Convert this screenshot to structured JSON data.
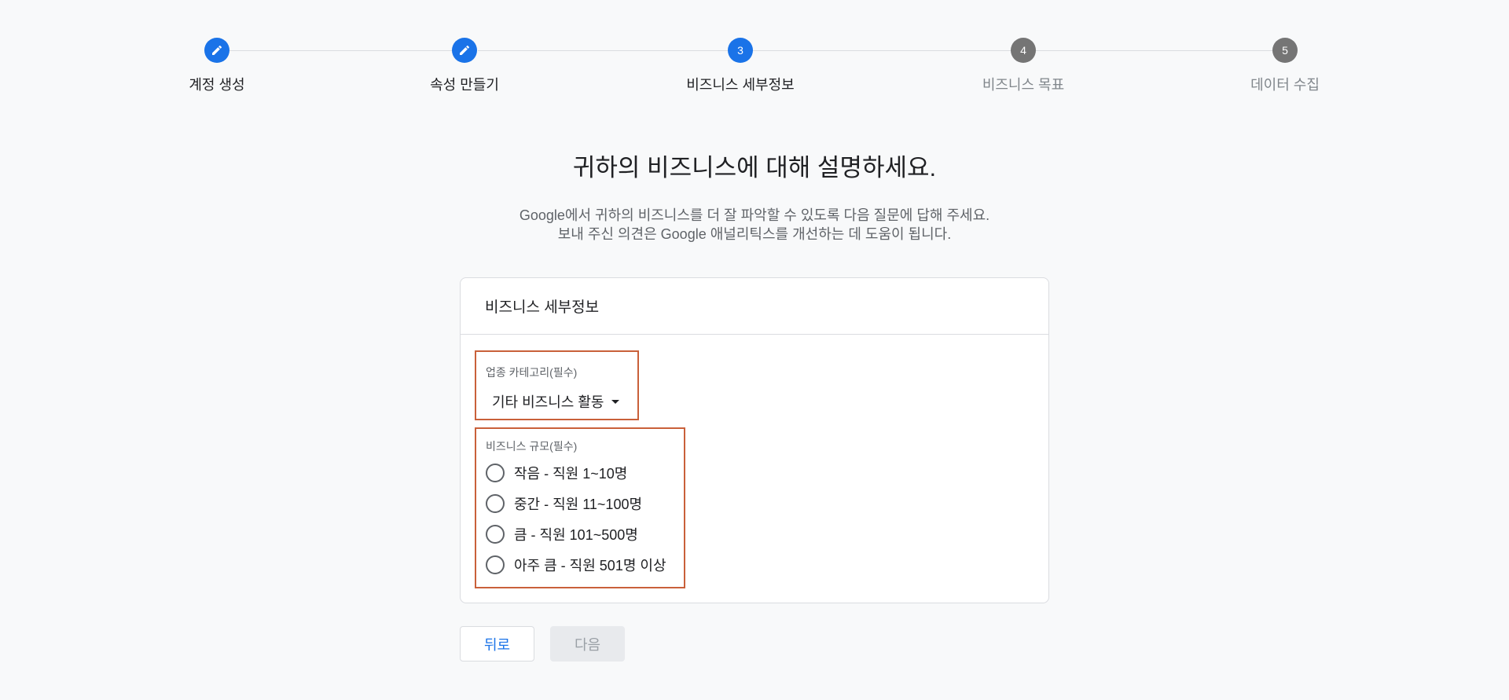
{
  "stepper": {
    "steps": [
      {
        "label": "계정 생성",
        "status": "completed",
        "icon": "pencil-icon",
        "number": ""
      },
      {
        "label": "속성 만들기",
        "status": "completed",
        "icon": "pencil-icon",
        "number": ""
      },
      {
        "label": "비즈니스 세부정보",
        "status": "current",
        "icon": "",
        "number": "3"
      },
      {
        "label": "비즈니스 목표",
        "status": "upcoming",
        "icon": "",
        "number": "4"
      },
      {
        "label": "데이터 수집",
        "status": "upcoming",
        "icon": "",
        "number": "5"
      }
    ]
  },
  "headline": "귀하의 비즈니스에 대해 설명하세요.",
  "subtext": {
    "line1": "Google에서 귀하의 비즈니스를 더 잘 파악할 수 있도록 다음 질문에 답해 주세요.",
    "line2": "보내 주신 의견은 Google 애널리틱스를 개선하는 데 도움이 됩니다."
  },
  "card": {
    "title": "비즈니스 세부정보",
    "industry": {
      "label": "업종 카테고리(필수)",
      "selected": "기타 비즈니스 활동"
    },
    "size": {
      "label": "비즈니스 규모(필수)",
      "options": [
        "작음 - 직원 1~10명",
        "중간 - 직원 11~100명",
        "큼 - 직원 101~500명",
        "아주 큼 - 직원 501명 이상"
      ]
    }
  },
  "buttons": {
    "back": "뒤로",
    "next": "다음"
  },
  "colors": {
    "accent": "#1a73e8",
    "highlight_border": "#c9603a",
    "inactive_step": "#757575"
  }
}
